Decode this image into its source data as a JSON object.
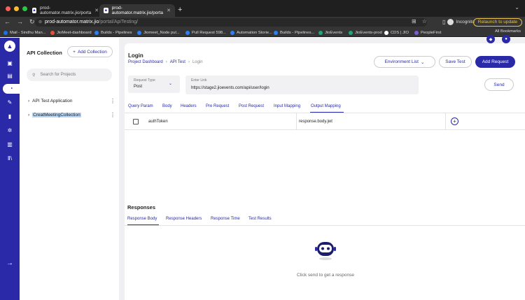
{
  "browser": {
    "tabs": [
      {
        "title": "prod-automator.matrix.jio/porta"
      },
      {
        "title": "prod-automator.matrix.jio/porta"
      }
    ],
    "url_host": "prod-automator.matrix.jio",
    "url_path": "/portal/ApiTesting/",
    "incognito_label": "Incognito",
    "relaunch_label": "Relaunch to update",
    "bookmarks": [
      {
        "label": "Mail - Sindhu Man...",
        "color": "#1a73e8"
      },
      {
        "label": "JioMeet-dashboard",
        "color": "#e8503a"
      },
      {
        "label": "Builds - Pipelines",
        "color": "#2d7ff9"
      },
      {
        "label": "Jiomeet_Node pul...",
        "color": "#2d7ff9"
      },
      {
        "label": "Pull Request 598...",
        "color": "#2d7ff9"
      },
      {
        "label": "Automation Storie...",
        "color": "#2d7ff9"
      },
      {
        "label": "Builds - Pipelines...",
        "color": "#2d7ff9"
      },
      {
        "label": "JioEvents",
        "color": "#1fa67a"
      },
      {
        "label": "JioEvents-prod",
        "color": "#1fa67a"
      },
      {
        "label": "CDS | JIO",
        "color": "#ffffff"
      },
      {
        "label": "PeopleFirst",
        "color": "#7b5cd6"
      }
    ],
    "all_bookmarks_label": "All Bookmarks"
  },
  "sidebar": {
    "title": "API Collection",
    "add_collection_label": "Add Collection",
    "search_placeholder": "Search for Projects",
    "items": [
      {
        "label": "API Test Application"
      },
      {
        "label": "CreatMeetingCollection"
      }
    ]
  },
  "header": {
    "title": "Login",
    "breadcrumb": [
      "Project Dashboard",
      "API Test",
      "Login"
    ],
    "environment_label": "Environment List",
    "save_label": "Save Test",
    "add_request_label": "Add Request"
  },
  "request": {
    "type_label": "Request Type",
    "type_value": "Post",
    "link_label": "Enter Link",
    "link_value": "https://stage2.jioevents.com/api/user/login",
    "send_label": "Send"
  },
  "tabs": [
    "Query Param",
    "Body",
    "Headers",
    "Pre Request",
    "Post Request",
    "Input Mapping",
    "Output Mapping"
  ],
  "mapping_row": {
    "key": "authToken",
    "value": "response.body.jwt"
  },
  "responses": {
    "title": "Responses",
    "tabs": [
      "Response Body",
      "Response Headers",
      "Response Time",
      "Test Results"
    ],
    "empty_message": "Click send to get a response"
  },
  "colors": {
    "accent": "#2a2aa8",
    "rail": "#2a2aa8"
  }
}
